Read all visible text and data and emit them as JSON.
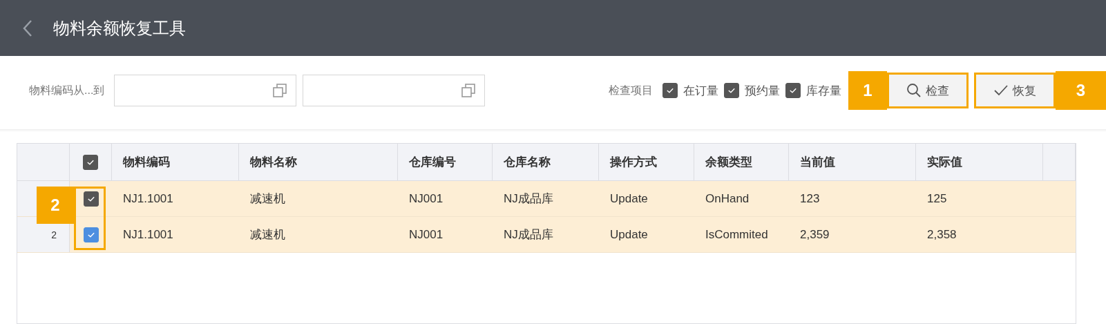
{
  "header": {
    "title": "物料余额恢复工具"
  },
  "filter": {
    "label": "物料编码从...到",
    "fields": [
      {
        "kind": "lookup"
      },
      {
        "kind": "lookup"
      }
    ]
  },
  "check_items": {
    "label": "检查项目",
    "options": [
      {
        "label": "在订量",
        "checked": true
      },
      {
        "label": "预约量",
        "checked": true
      },
      {
        "label": "库存量",
        "checked": true
      }
    ]
  },
  "buttons": [
    {
      "label": "检查",
      "kind": "search"
    },
    {
      "label": "恢复",
      "kind": "check"
    }
  ],
  "table": {
    "select_all": true,
    "columns": [
      "物料编码",
      "物料名称",
      "仓库编号",
      "仓库名称",
      "操作方式",
      "余额类型",
      "当前值",
      "实际值"
    ],
    "rows": [
      {
        "number": "",
        "checked": true,
        "color": "#555555",
        "cells": [
          "NJ1.1001",
          "减速机",
          "NJ001",
          "NJ成品库",
          "Update",
          "OnHand",
          "123",
          "125"
        ]
      },
      {
        "number": "2",
        "checked": true,
        "color": "#4d8fe0",
        "cells": [
          "NJ1.1001",
          "减速机",
          "NJ001",
          "NJ成品库",
          "Update",
          "IsCommited",
          "2,359",
          "2,358"
        ]
      }
    ]
  },
  "callouts": [
    {
      "label": "1",
      "kind": "search-button"
    },
    {
      "label": "2",
      "kind": "row-checks"
    },
    {
      "label": "3",
      "kind": "restore-button"
    }
  ]
}
